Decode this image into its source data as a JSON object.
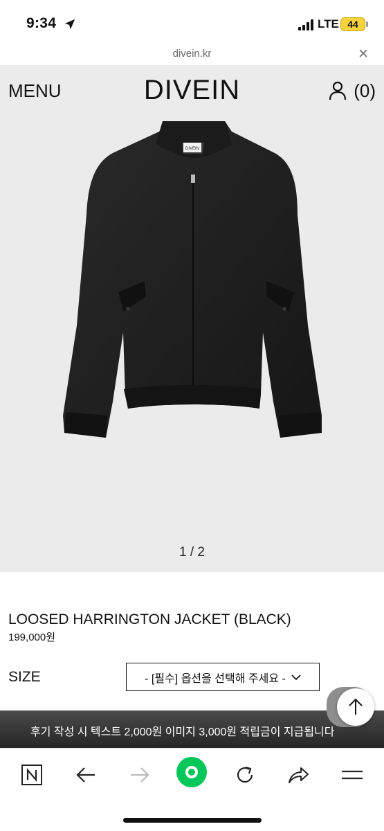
{
  "status_bar": {
    "time": "9:34",
    "network": "LTE",
    "battery": "44"
  },
  "browser": {
    "url": "divein.kr",
    "close_label": "✕"
  },
  "header": {
    "menu_label": "MENU",
    "logo": "DIVEIN",
    "cart_count": "(0)"
  },
  "gallery": {
    "label_tag": "DIVEIN",
    "pager": "1 / 2"
  },
  "product": {
    "name": "LOOSED HARRINGTON JACKET (BLACK)",
    "price": "199,000원",
    "size_label": "SIZE",
    "size_select": "- [필수] 옵션을 선택해 주세요 -"
  },
  "banner": {
    "text": "후기 작성 시 텍스트 2,000원 이미지 3,000원 적립금이 지급됩니다"
  },
  "toolbar": {
    "icons": [
      "naver-icon",
      "back-arrow-icon",
      "forward-arrow-icon",
      "green-dot-icon",
      "reload-icon",
      "share-icon",
      "menu-icon"
    ]
  },
  "colors": {
    "hero_bg": "#ebebeb",
    "accent_green": "#03c75a",
    "battery_yellow": "#f7d23b"
  }
}
